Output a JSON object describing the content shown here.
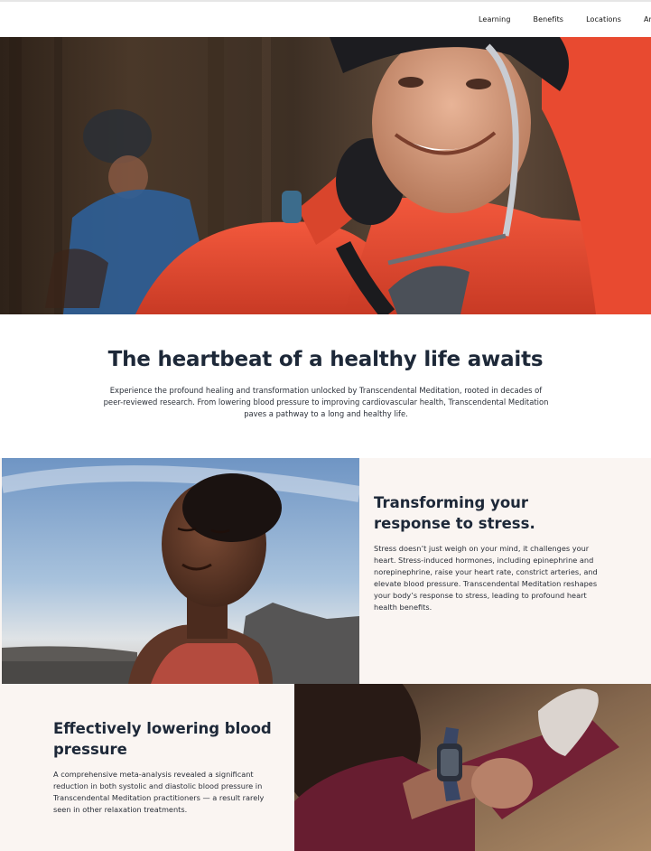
{
  "nav": {
    "items": [
      "Learning",
      "Benefits",
      "Locations",
      "Arti"
    ]
  },
  "hero": {
    "image_icon": "hero-photo-cyclists"
  },
  "intro": {
    "title": "The heartbeat of a healthy life awaits",
    "body": "Experience the profound healing and transformation unlocked by Transcendental Meditation, rooted in decades of peer-reviewed research. From lowering blood pressure to improving cardiovascular health, Transcendental Meditation paves a pathway to a long and healthy life."
  },
  "stress": {
    "title": "Transforming your response to stress.",
    "body": "Stress doesn’t just weigh on your mind, it challenges your heart. Stress-induced hormones, including epinephrine and norepinephrine, raise your heart rate, constrict arteries, and elevate blood pressure. Transcendental Meditation reshapes your body’s response to stress, leading to profound heart health benefits."
  },
  "blood_pressure": {
    "title": "Effectively lowering blood pressure",
    "body": "A comprehensive meta-analysis revealed a significant reduction in both systolic and diastolic blood pressure in Transcendental Meditation practitioners — a result rarely seen in other relaxation treatments."
  },
  "colors": {
    "heading": "#1d2838",
    "band_background": "#faf5f2",
    "jacket_orange": "#e8492f"
  }
}
